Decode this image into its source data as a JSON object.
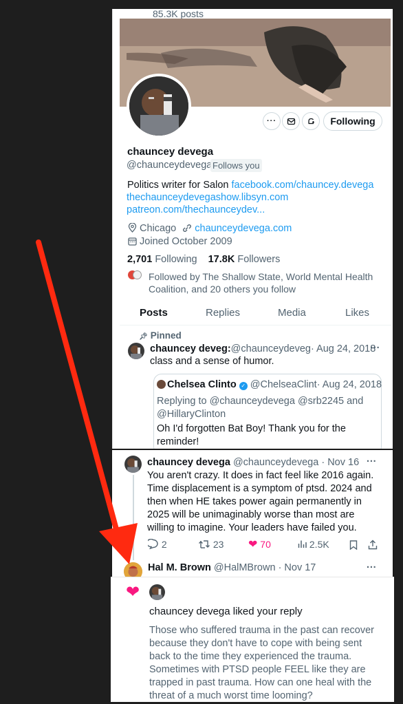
{
  "profile": {
    "posts_count": "85.3K posts",
    "name": "chauncey devega",
    "handle": "@chaunceydevega",
    "follows_you": "Follows you",
    "bio_text": "Politics writer for Salon",
    "bio_link1": "facebook.com/chauncey.devega",
    "bio_link2": "thechaunceydevegashow.libsyn.com",
    "bio_link3": "patreon.com/thechaunceydev...",
    "location": "Chicago",
    "website": "chaunceydevega.com",
    "joined": "Joined October 2009",
    "following_count": "2,701",
    "following_label": "Following",
    "followers_count": "17.8K",
    "followers_label": "Followers",
    "followed_by_line1": "Followed by The Shallow State, World Mental Health",
    "followed_by_line2": "Coalition, and 20 others you follow",
    "following_button": "Following",
    "tabs": [
      "Posts",
      "Replies",
      "Media",
      "Likes"
    ]
  },
  "pinned": {
    "label": "Pinned",
    "name": "chauncey deveg:",
    "handle": "@chaunceydeveg",
    "date": "· Aug 24, 2018",
    "text": "class and a sense of humor.",
    "quote": {
      "name": "Chelsea Clinto",
      "handle": "@ChelseaClint",
      "date": "· Aug 24, 2018",
      "reply_line1": "Replying to @chaunceydevega @srb2245 and",
      "reply_line2": "@HillaryClinton",
      "text_line1": "Oh I'd forgotten Bat Boy! Thank you for the",
      "text_line2": "reminder!"
    }
  },
  "tweet": {
    "name": "chauncey devega",
    "handle": "@chaunceydevega",
    "date": "· Nov 16",
    "lines": [
      "You aren't crazy. It does in fact feel like 2016 again.",
      "Time displacement is a symptom of ptsd. 2024 and",
      "then when HE takes power again permanently in",
      "2025 will be unimaginably worse than most are",
      "willing to imagine. Your leaders have failed you."
    ],
    "replies": "2",
    "retweets": "23",
    "likes": "70",
    "views": "2.5K"
  },
  "reply": {
    "name": "Hal M. Brown",
    "handle": "@HalMBrown",
    "date": "· Nov 17"
  },
  "notification": {
    "title": "chauncey devega liked your reply",
    "lines": [
      "Those who suffered trauma in the past can recover",
      "because they don't have to cope with being sent",
      "back to the time they experienced the trauma.",
      "Sometimes with PTSD people FEEL like they are",
      "trapped in past trauma. How can one heal with the",
      "threat of a  much worst time looming?"
    ]
  },
  "colors": {
    "link": "#1d9bf0",
    "like": "#f91880",
    "arrow": "#ff2a10",
    "verified": "#1d9bf0"
  }
}
